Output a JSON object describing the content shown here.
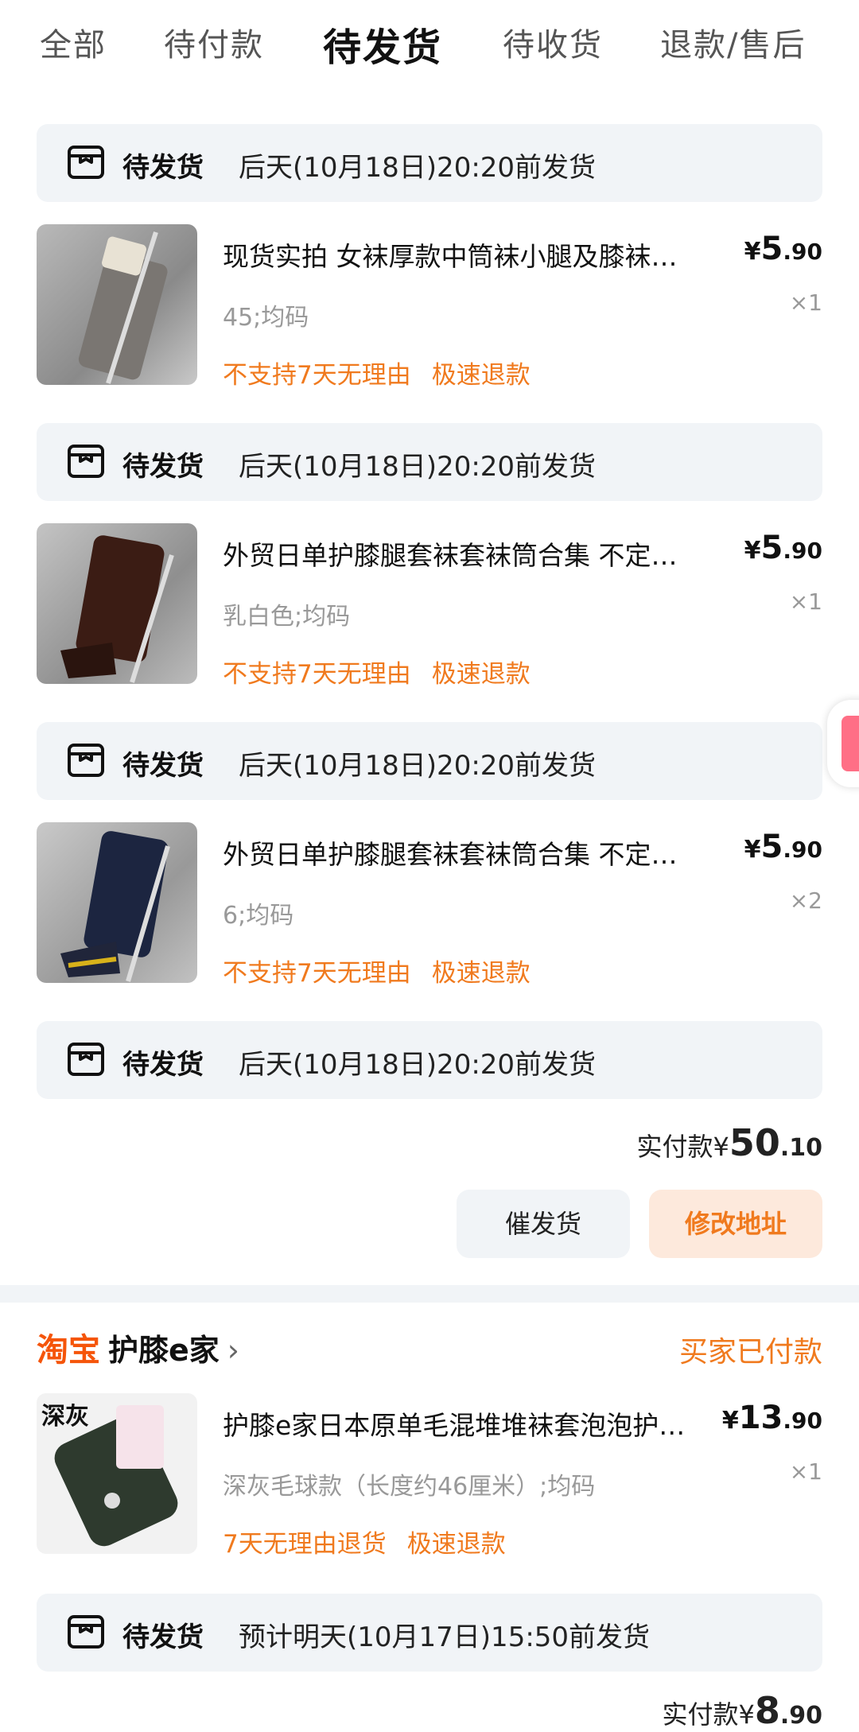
{
  "tabs": [
    "全部",
    "待付款",
    "待发货",
    "待收货",
    "退款/售后"
  ],
  "faded_text": "…",
  "status_rows": [
    {
      "status": "待发货",
      "deadline": "后天(10月18日)20:20前发货"
    },
    {
      "status": "待发货",
      "deadline": "后天(10月18日)20:20前发货"
    },
    {
      "status": "待发货",
      "deadline": "后天(10月18日)20:20前发货"
    },
    {
      "status": "待发货",
      "deadline": "后天(10月18日)20:20前发货"
    },
    {
      "status": "待发货",
      "deadline": "预计明天(10月17日)15:50前发货"
    }
  ],
  "items": [
    {
      "title": "现货实拍 女袜厚款中筒袜小腿及膝袜…",
      "spec": "45;均码",
      "tag1": "不支持7天无理由",
      "tag2": "极速退款",
      "yen": "¥",
      "price_int": "5",
      "price_dec": ".90",
      "qty": "×1",
      "thumb_color": "gray"
    },
    {
      "title": "外贸日单护膝腿套袜套袜筒合集 不定…",
      "spec": "乳白色;均码",
      "tag1": "不支持7天无理由",
      "tag2": "极速退款",
      "yen": "¥",
      "price_int": "5",
      "price_dec": ".90",
      "qty": "×1",
      "thumb_color": "brown"
    },
    {
      "title": "外贸日单护膝腿套袜套袜筒合集 不定…",
      "spec": "6;均码",
      "tag1": "不支持7天无理由",
      "tag2": "极速退款",
      "yen": "¥",
      "price_int": "5",
      "price_dec": ".90",
      "qty": "×2",
      "thumb_color": "navy"
    },
    {
      "title": "护膝e家日本原单毛混堆堆袜套泡泡护…",
      "spec": "深灰毛球款（长度约46厘米）;均码",
      "tag1": "7天无理由退货",
      "tag2": "极速退款",
      "yen": "¥",
      "price_int": "13",
      "price_dec": ".90",
      "qty": "×1",
      "thumb_color": "darkgreen",
      "thumb_label": "深灰"
    }
  ],
  "order1": {
    "total_label": "实付款",
    "yen": "¥",
    "total_int": "50",
    "total_dec": ".10",
    "btn_urge": "催发货",
    "btn_address": "修改地址"
  },
  "order2": {
    "platform": "淘宝",
    "shop_name": "护膝e家",
    "chevron": "›",
    "shop_status": "买家已付款",
    "total_label": "实付款",
    "yen": "¥",
    "total_int": "8",
    "total_dec": ".90"
  },
  "colors": {
    "accent": "#f07a1e",
    "platform_orange": "#f5550a",
    "panel": "#f1f4f7"
  }
}
